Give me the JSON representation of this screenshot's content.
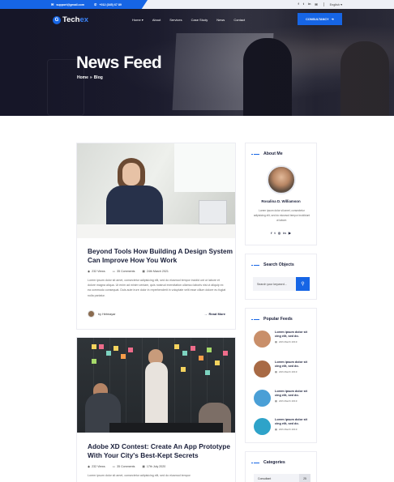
{
  "topbar": {
    "email": "support@gmail.com",
    "phone": "+012 (345) 67 89",
    "social": [
      "f",
      "t",
      "in",
      "✉"
    ],
    "language": "English"
  },
  "nav": {
    "logo_first": "Tech",
    "logo_second": "ex",
    "menu": [
      "Home",
      "About",
      "Services",
      "Case Study",
      "News",
      "Contact"
    ],
    "cta": "CONSULTANCY"
  },
  "hero": {
    "title": "News Feed",
    "breadcrumb_home": "Home",
    "breadcrumb_sep": "»",
    "breadcrumb_current": "Blog"
  },
  "posts": [
    {
      "title": "Beyond Tools How Building A Design System Can Improve How You Work",
      "views": "232 Views",
      "comments": "35 Comments",
      "date": "24th March 2021",
      "excerpt": "Lorem ipsum dolor sit amet, consectetur adipisicing elit, sed do eiusmod tempor incidid unt ut labore et dolore magna aliqua. Ut enim ad minim veniam, quis nostrud exercitation ullamco laboris nisi ut aliquip ex ea commodo consequat. Duis aute irure dolor in reprehenderit in voluptate velit esse cillum dolore eu fugiat nulla pariatur.",
      "author": "by Hetmayar",
      "read_more": "Read More"
    },
    {
      "title": "Adobe XD Contest: Create An App Prototype With Your City's Best-Kept Secrets",
      "views": "232 Views",
      "comments": "35 Comments",
      "date": "17th July 2020",
      "excerpt": "Lorem ipsum dolor sit amet, consectetur adipisicing elit, sed do eiusmod tempor"
    }
  ],
  "sidebar": {
    "about": {
      "title": "About Me",
      "name": "Rosalina D. Williamson",
      "text": "Lorem ipsum dolor sit amet, consectetur adipisicing elit, sed do eiusmod tempor incididunt ut labore.",
      "social": [
        "f",
        "t",
        "◎",
        "in",
        "▶"
      ]
    },
    "search": {
      "title": "Search Objects",
      "placeholder": "Search your keyword..."
    },
    "popular": {
      "title": "Popular Feeds",
      "items": [
        {
          "title": "Lorem ipsum dolor sit cing elit, sed do.",
          "date": "24th March 2019",
          "color": "#c98f6a"
        },
        {
          "title": "Lorem ipsum dolor sit cing elit, sed do.",
          "date": "24th March 2019",
          "color": "#a86a45"
        },
        {
          "title": "Lorem ipsum dolor sit cing elit, sed do.",
          "date": "24th March 2019",
          "color": "#4a9fd6"
        },
        {
          "title": "Lorem ipsum dolor sit cing elit, sed do.",
          "date": "24th March 2019",
          "color": "#2ea3c9"
        }
      ]
    },
    "categories": {
      "title": "Categories",
      "items": [
        {
          "name": "Consultant",
          "count": "25"
        }
      ]
    }
  },
  "colors": {
    "accent": "#1665e5",
    "heading": "#1a1f3a"
  }
}
